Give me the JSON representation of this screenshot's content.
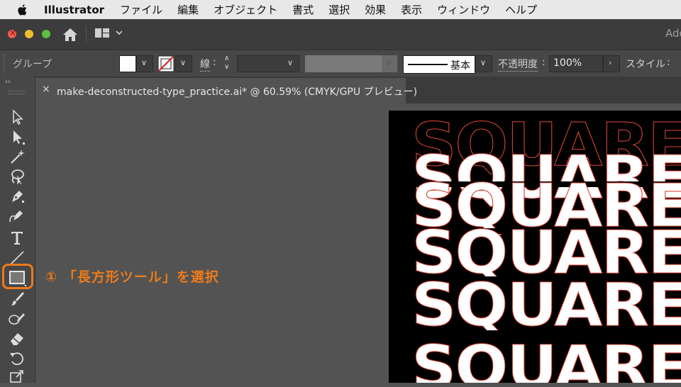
{
  "menubar": {
    "app_name": "Illustrator",
    "items": [
      "ファイル",
      "編集",
      "オブジェクト",
      "書式",
      "選択",
      "効果",
      "表示",
      "ウィンドウ",
      "ヘルプ"
    ]
  },
  "titlebar": {
    "right_text": "Ado"
  },
  "controlbar": {
    "selection_label": "グループ",
    "stroke_label": "線",
    "stroke_colon": ":",
    "brush_label": "基本",
    "opacity_label": "不透明度",
    "opacity_colon": ":",
    "opacity_value": "100%",
    "style_label": "スタイル",
    "style_colon": ":"
  },
  "document_tab": {
    "close_glyph": "×",
    "title": "make-deconstructed-type_practice.ai* @ 60.59% (CMYK/GPU プレビュー)"
  },
  "annotation": {
    "text": "① 「長方形ツール」を選択",
    "color": "#ee7a1a"
  },
  "artboard": {
    "word": "SQUARE",
    "background": "#000000",
    "outline_color": "#e0473a"
  },
  "toolbar": {
    "collapse_glyph": "››",
    "tools": [
      "selection-tool",
      "direct-selection-tool",
      "magic-wand-tool",
      "lasso-tool",
      "pen-tool",
      "curvature-tool",
      "type-tool",
      "line-segment-tool",
      "rectangle-tool",
      "paintbrush-tool",
      "shaper-tool",
      "eraser-tool",
      "rotate-tool",
      "scale-tool"
    ],
    "selected_tool": "rectangle-tool"
  }
}
